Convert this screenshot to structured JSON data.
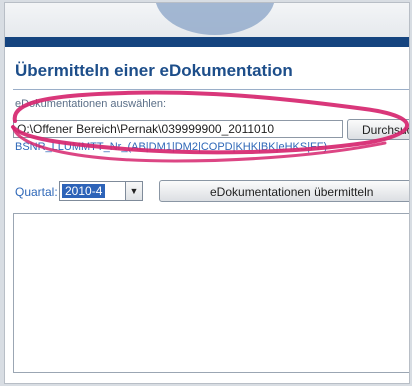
{
  "page": {
    "title": "Übermitteln einer eDokumentation"
  },
  "upload": {
    "label": "eDokumentationen auswählen:",
    "path_value": "O:\\Offener Bereich\\Pernak\\039999900_2011010",
    "browse_label": "Durchsuchen...",
    "filename_hint": "BSNR_LLUMMTT_Nr_(AB|DM1|DM2|COPD|KHK|BK|eHKS|FF)"
  },
  "submit": {
    "quartal_label": "Quartal:",
    "quartal_value": "2010-4",
    "button_label": "eDokumentationen übermitteln"
  },
  "icons": {
    "dropdown": "chevron-down-icon"
  },
  "colors": {
    "accent_blue": "#1d4e8a",
    "header_bar": "#15447f",
    "annotation": "#d6266f"
  }
}
